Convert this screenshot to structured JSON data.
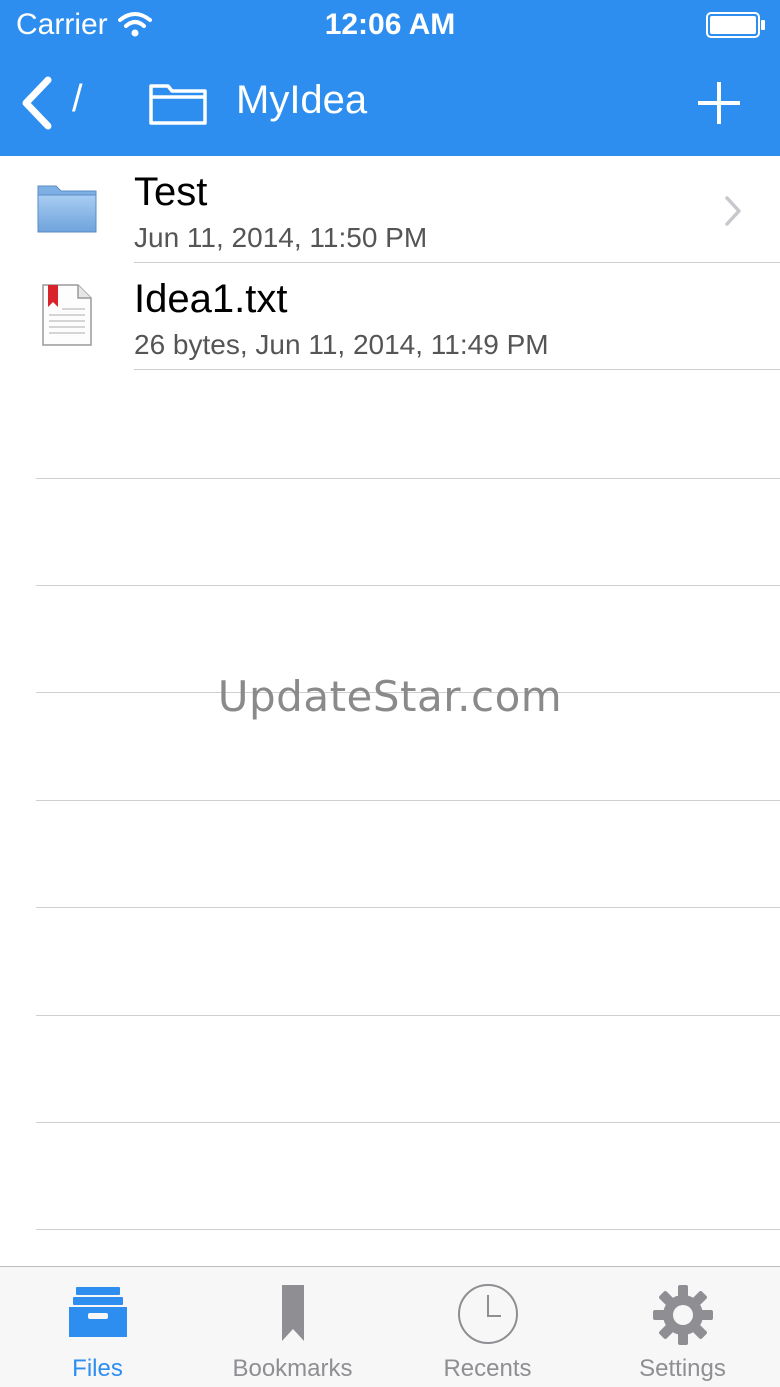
{
  "status_bar": {
    "carrier": "Carrier",
    "time": "12:06 AM"
  },
  "nav": {
    "back_icon": "chevron-left-icon",
    "path": "/",
    "folder_icon": "folder-outline-icon",
    "title": "MyIdea",
    "add_icon": "plus-icon"
  },
  "files": [
    {
      "name": "Test",
      "meta": "Jun 11, 2014, 11:50 PM",
      "type": "folder",
      "icon": "folder-icon",
      "has_chevron": true
    },
    {
      "name": "Idea1.txt",
      "meta": "26 bytes, Jun 11, 2014, 11:49 PM",
      "type": "text-file",
      "icon": "text-file-icon",
      "has_chevron": false
    }
  ],
  "watermark": "UpdateStar.com",
  "tabs": [
    {
      "label": "Files",
      "icon": "files-tray-icon",
      "active": true
    },
    {
      "label": "Bookmarks",
      "icon": "bookmark-icon",
      "active": false
    },
    {
      "label": "Recents",
      "icon": "clock-icon",
      "active": false
    },
    {
      "label": "Settings",
      "icon": "gear-icon",
      "active": false
    }
  ],
  "colors": {
    "accent": "#2d8ef0",
    "tab_inactive": "#8e8e93",
    "separator": "#cfcfcf"
  }
}
